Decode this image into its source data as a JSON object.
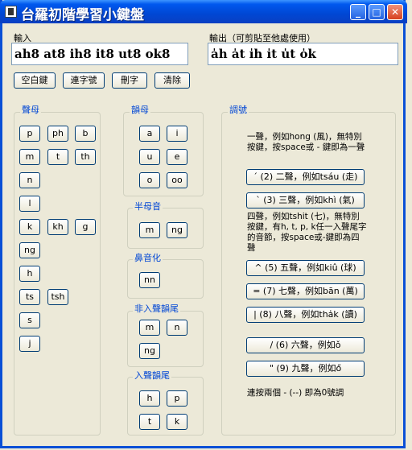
{
  "window": {
    "title": "台羅初階學習小鍵盤"
  },
  "input": {
    "label": "輸入",
    "value": "ah8 at8 ih8 it8 ut8 ok8"
  },
  "output": {
    "label": "輸出（可剪貼至他處使用）",
    "value": "a̍h a̍t i̍h i̍t u̍t o̍k"
  },
  "actions": {
    "space": "空白鍵",
    "hyphen": "連字號",
    "delete": "刪字",
    "clear": "清除"
  },
  "initials": {
    "title": "聲母",
    "keys": [
      "p",
      "ph",
      "b",
      "m",
      "t",
      "th",
      "n",
      "l",
      "k",
      "kh",
      "g",
      "ng",
      "h",
      "ts",
      "tsh",
      "s",
      "j"
    ]
  },
  "finals": {
    "title": "韻母",
    "keys": [
      "a",
      "i",
      "u",
      "e",
      "o",
      "oo"
    ]
  },
  "half_nasal": {
    "title": "半母音",
    "keys": [
      "m",
      "ng"
    ]
  },
  "nasalization": {
    "title": "鼻音化",
    "keys": [
      "nn"
    ]
  },
  "non_checked": {
    "title": "非入聲韻尾",
    "keys": [
      "m",
      "n",
      "ng"
    ]
  },
  "checked": {
    "title": "入聲韻尾",
    "keys": [
      "h",
      "p",
      "t",
      "k"
    ]
  },
  "tones": {
    "title": "調號",
    "tone1_note": "一聲，例如hong (風)，無特別按鍵，按space或 - 鍵即為一聲",
    "tone2": "ˊ (2) 二聲，例如tsáu (走)",
    "tone3": "ˋ (3) 三聲，例如khì (氣)",
    "tone4_note": "四聲，例如tshit (七)，無特別按鍵，有h, t, p, k任一入聲尾字的音節，按space或-鍵即為四聲",
    "tone5": "^ (5) 五聲，例如kiû (球)",
    "tone7": "= (7) 七聲，例如bān (萬)",
    "tone8": "| (8) 八聲，例如tha̍k (讀)",
    "tone6": "/ (6) 六聲，例如ǒ",
    "tone9": "\" (9) 九聲，例如ő",
    "zero_note": "連按兩個 - (--) 即為0號調"
  }
}
